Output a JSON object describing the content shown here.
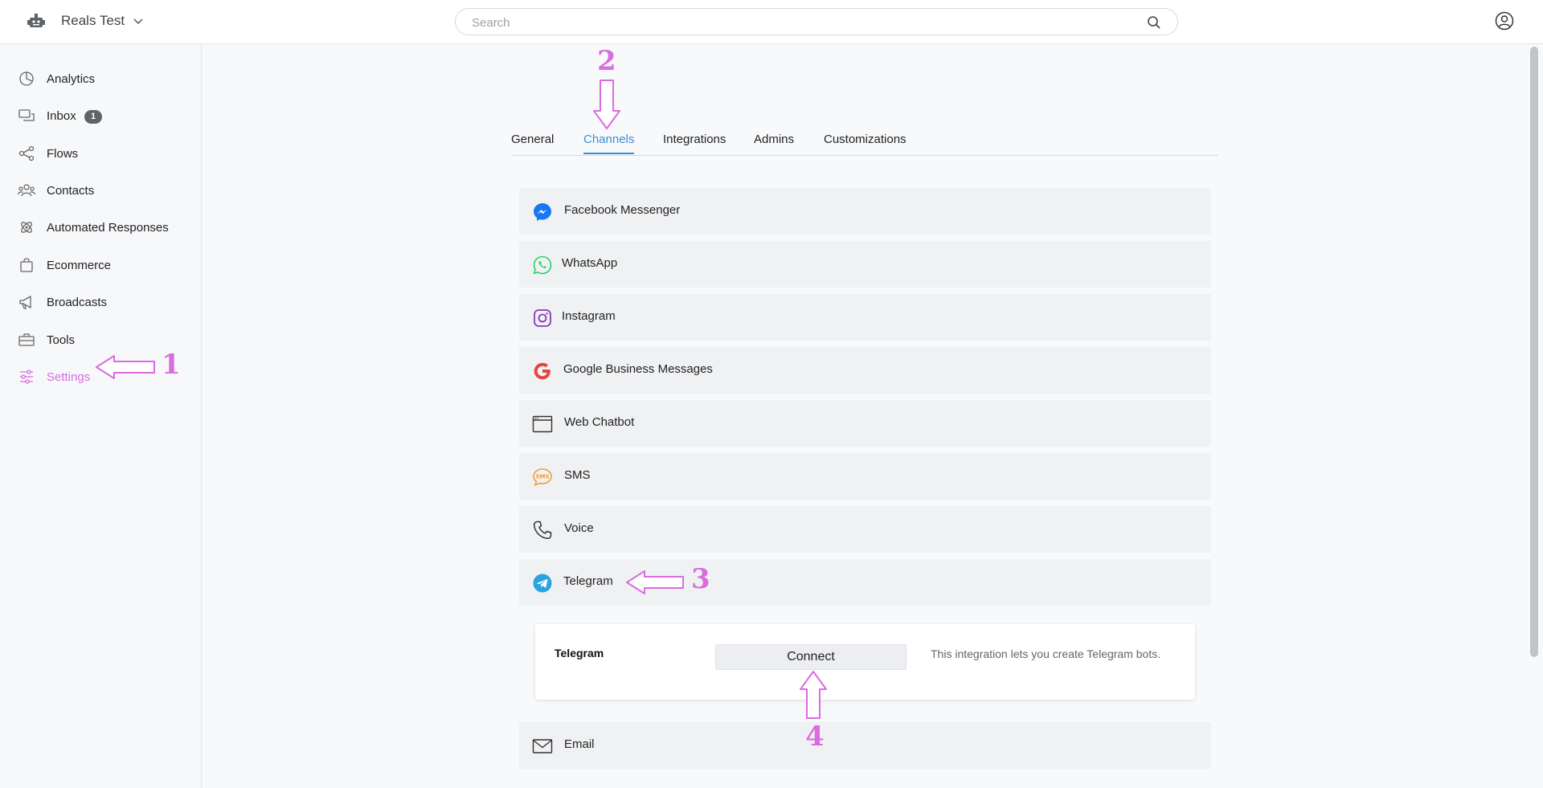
{
  "header": {
    "workspace_name": "Reals Test",
    "search_placeholder": "Search"
  },
  "sidebar": {
    "items": [
      {
        "label": "Analytics"
      },
      {
        "label": "Inbox",
        "badge": "1"
      },
      {
        "label": "Flows"
      },
      {
        "label": "Contacts"
      },
      {
        "label": "Automated Responses"
      },
      {
        "label": "Ecommerce"
      },
      {
        "label": "Broadcasts"
      },
      {
        "label": "Tools"
      },
      {
        "label": "Settings",
        "active": true
      }
    ]
  },
  "tabs": [
    {
      "label": "General"
    },
    {
      "label": "Channels",
      "active": true
    },
    {
      "label": "Integrations"
    },
    {
      "label": "Admins"
    },
    {
      "label": "Customizations"
    }
  ],
  "channels": [
    {
      "label": "Facebook Messenger",
      "icon": "messenger-icon"
    },
    {
      "label": "WhatsApp",
      "icon": "whatsapp-icon"
    },
    {
      "label": "Instagram",
      "icon": "instagram-icon"
    },
    {
      "label": "Google Business Messages",
      "icon": "google-icon"
    },
    {
      "label": "Web Chatbot",
      "icon": "browser-window-icon"
    },
    {
      "label": "SMS",
      "icon": "sms-icon"
    },
    {
      "label": "Voice",
      "icon": "phone-icon"
    },
    {
      "label": "Telegram",
      "icon": "telegram-icon"
    },
    {
      "label": "Email",
      "icon": "envelope-icon"
    }
  ],
  "telegram_panel": {
    "title": "Telegram",
    "button_label": "Connect",
    "description": "This integration lets you create Telegram bots."
  },
  "annotations": {
    "step1": "1",
    "step2": "2",
    "step3": "3",
    "step4": "4"
  },
  "colors": {
    "accent_blue": "#3b8fd8",
    "annotation_pink": "#d96ce0",
    "active_settings": "#d96ce0"
  }
}
